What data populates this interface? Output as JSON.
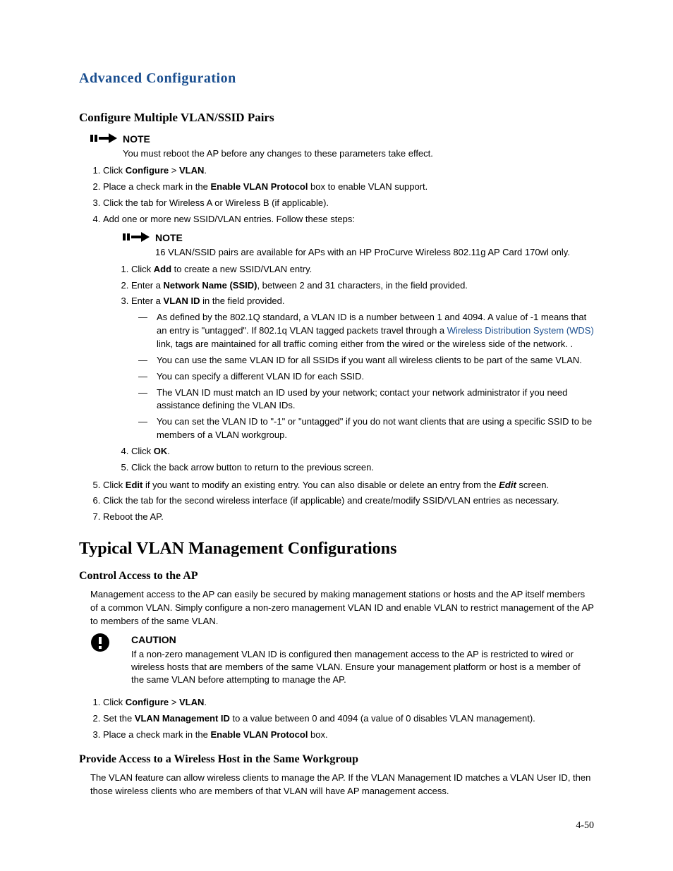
{
  "chapterTitle": "Advanced Configuration",
  "section1": {
    "title": "Configure Multiple VLAN/SSID Pairs",
    "note1": {
      "label": "NOTE",
      "text": "You must reboot the AP before any changes to these parameters take effect."
    },
    "steps": {
      "s1_a": "Click ",
      "s1_b": "Configure",
      "s1_c": " > ",
      "s1_d": "VLAN",
      "s1_e": ".",
      "s2_a": "Place a check mark in the ",
      "s2_b": "Enable VLAN Protocol",
      "s2_c": " box to enable VLAN support.",
      "s3": "Click the tab for Wireless A or Wireless B (if applicable).",
      "s4": "Add one or more new SSID/VLAN entries. Follow these steps:"
    },
    "note2": {
      "label": "NOTE",
      "text": "16 VLAN/SSID pairs are available for APs with an HP ProCurve Wireless 802.11g AP Card 170wl only."
    },
    "sub": {
      "a1_a": "Click ",
      "a1_b": "Add",
      "a1_c": " to create a new SSID/VLAN entry.",
      "a2_a": "Enter a ",
      "a2_b": "Network Name (SSID)",
      "a2_c": ", between 2 and 31 characters, in the field provided.",
      "a3_a": "Enter a ",
      "a3_b": "VLAN ID",
      "a3_c": " in the field provided.",
      "dash1_a": "As defined by the 802.1Q standard, a VLAN ID is a number between 1 and 4094. A value of -1 means that an entry is \"untagged\". If 802.1q VLAN tagged packets travel through a ",
      "dash1_link": "Wireless Distribution System (WDS)",
      "dash1_b": " link, tags are maintained for all traffic coming either from the wired or the wireless side of the network. .",
      "dash2": "You can use the same VLAN ID for all SSIDs if you want all wireless clients to be part of the same VLAN.",
      "dash3": "You can specify a different VLAN ID for each SSID.",
      "dash4": "The VLAN ID must match an ID used by your network; contact your network administrator if you need assistance defining the VLAN IDs.",
      "dash5": "You can set the VLAN ID to \"-1\" or \"untagged\" if you do not want clients that are using a specific SSID to be members of a VLAN workgroup.",
      "a4_a": "Click ",
      "a4_b": "OK",
      "a4_c": ".",
      "a5": "Click the back arrow button to return to the previous screen."
    },
    "steps2": {
      "s5_a": "Click ",
      "s5_b": "Edit",
      "s5_c": " if you want to modify an existing entry. You can also disable or delete an entry from the ",
      "s5_d": "Edit",
      "s5_e": " screen.",
      "s6": "Click the tab for the second wireless interface (if applicable) and create/modify SSID/VLAN entries as necessary.",
      "s7": "Reboot the AP."
    }
  },
  "section2": {
    "title": "Typical VLAN Management Configurations",
    "part1": {
      "title": "Control Access to the AP",
      "para": "Management access to the AP can easily be secured by making management stations or hosts and the AP itself members of a common VLAN. Simply configure a non-zero management VLAN ID and enable VLAN to restrict management of the AP to members of the same VLAN.",
      "caution": {
        "label": "CAUTION",
        "text": "If a non-zero management VLAN ID is configured then management access to the AP is restricted to wired or wireless hosts that are members of the same VLAN. Ensure your management platform or host is a member of the same VLAN before attempting to manage the AP."
      },
      "steps": {
        "s1_a": "Click ",
        "s1_b": "Configure",
        "s1_c": " > ",
        "s1_d": "VLAN",
        "s1_e": ".",
        "s2_a": "Set the ",
        "s2_b": "VLAN Management ID",
        "s2_c": " to a value between 0 and 4094 (a value of 0 disables VLAN management).",
        "s3_a": "Place a check mark in the ",
        "s3_b": "Enable VLAN Protocol",
        "s3_c": " box."
      }
    },
    "part2": {
      "title": "Provide Access to a Wireless Host in the Same Workgroup",
      "para": "The VLAN feature can allow wireless clients to manage the AP. If the VLAN Management ID matches a VLAN User ID, then those wireless clients who are members of that VLAN will have AP management access."
    }
  },
  "pageNumber": "4-50"
}
